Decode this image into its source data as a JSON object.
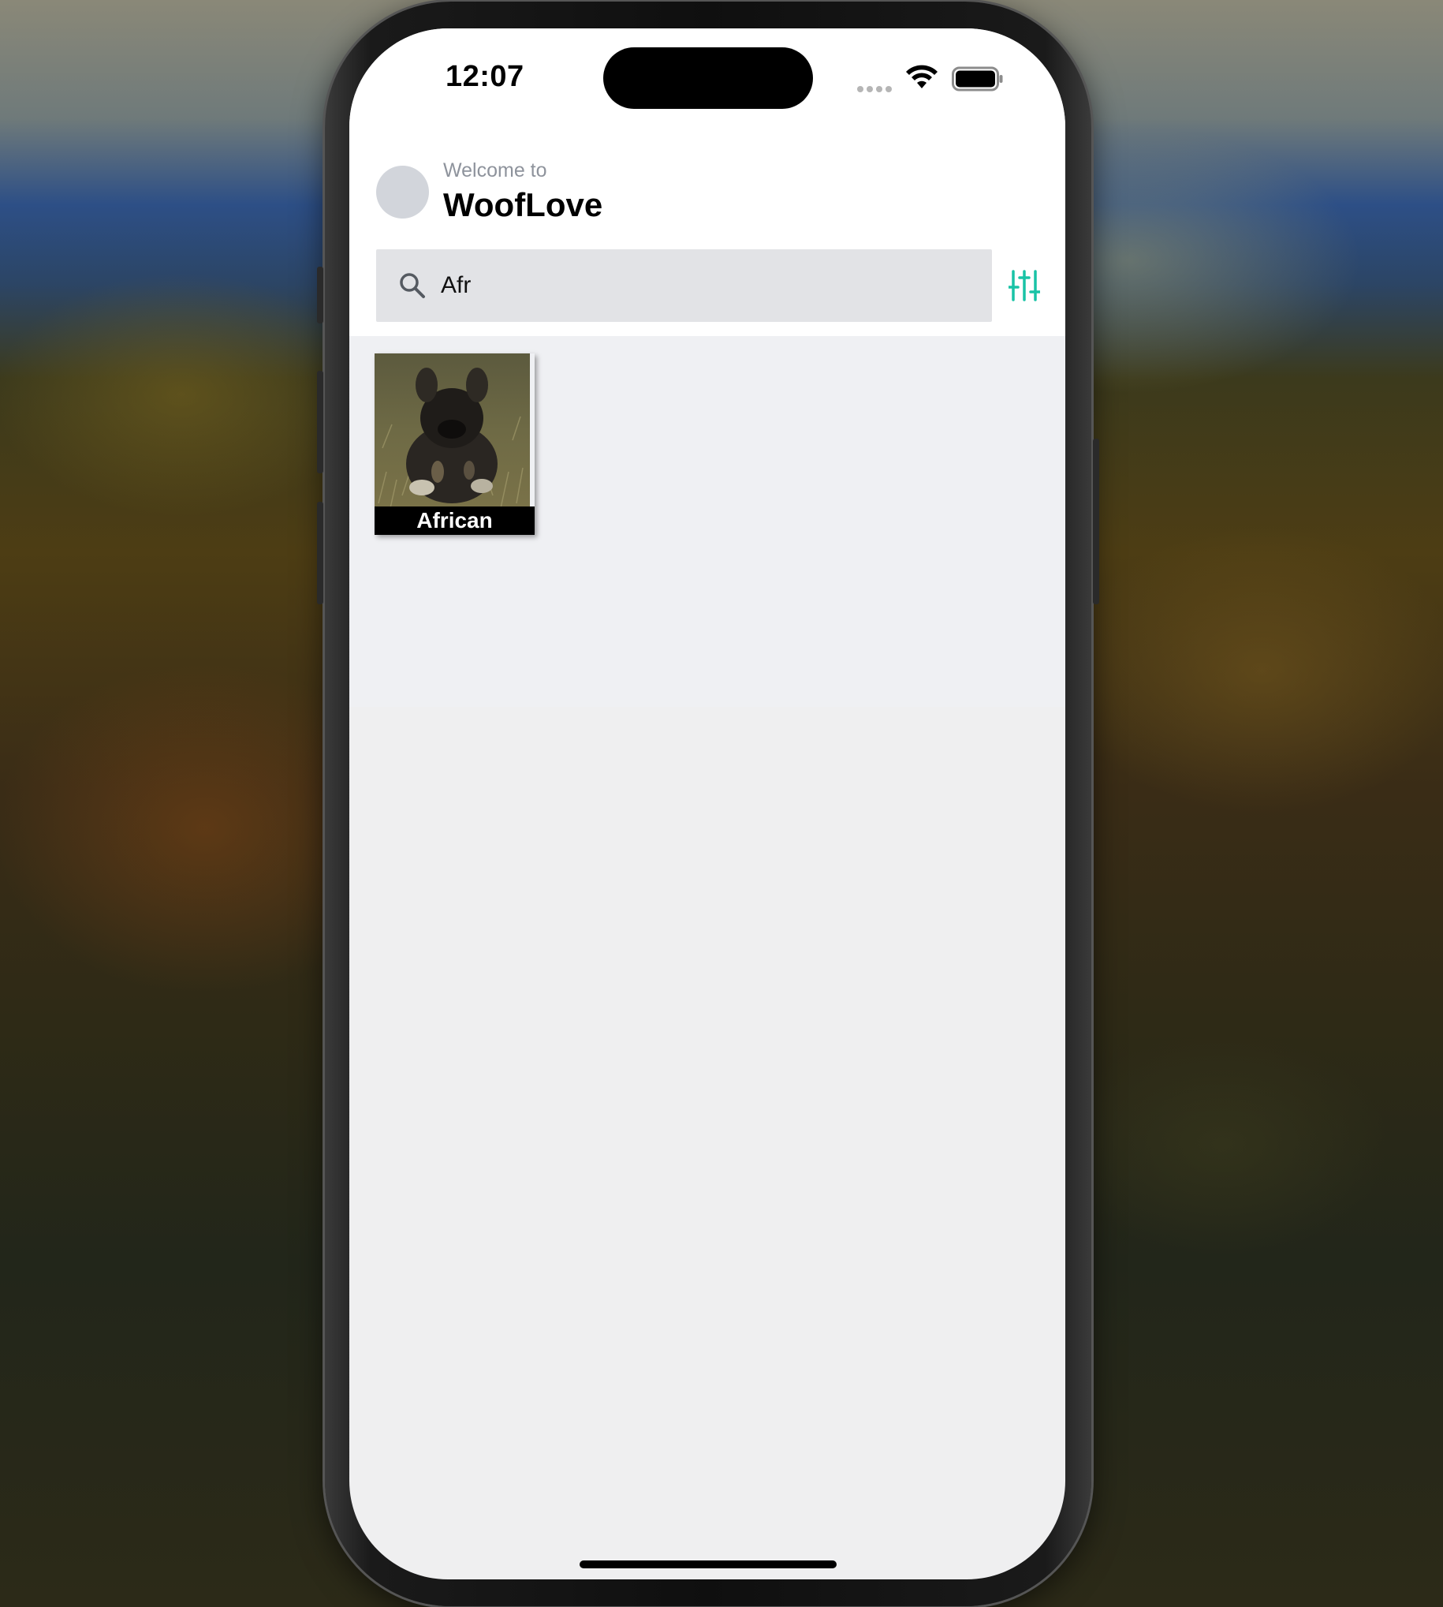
{
  "status_bar": {
    "time": "12:07"
  },
  "header": {
    "welcome_text": "Welcome to",
    "app_name": "WoofLove"
  },
  "search": {
    "value": "Afr"
  },
  "results": [
    {
      "breed": "African"
    }
  ],
  "colors": {
    "accent": "#19c3a6",
    "header_background": "#ffffff",
    "search_background": "#e2e3e6",
    "results_background": "#eff0f3"
  },
  "icons": {
    "search": "search-icon",
    "filter": "sliders-icon",
    "wifi": "wifi-icon",
    "battery": "battery-icon"
  }
}
